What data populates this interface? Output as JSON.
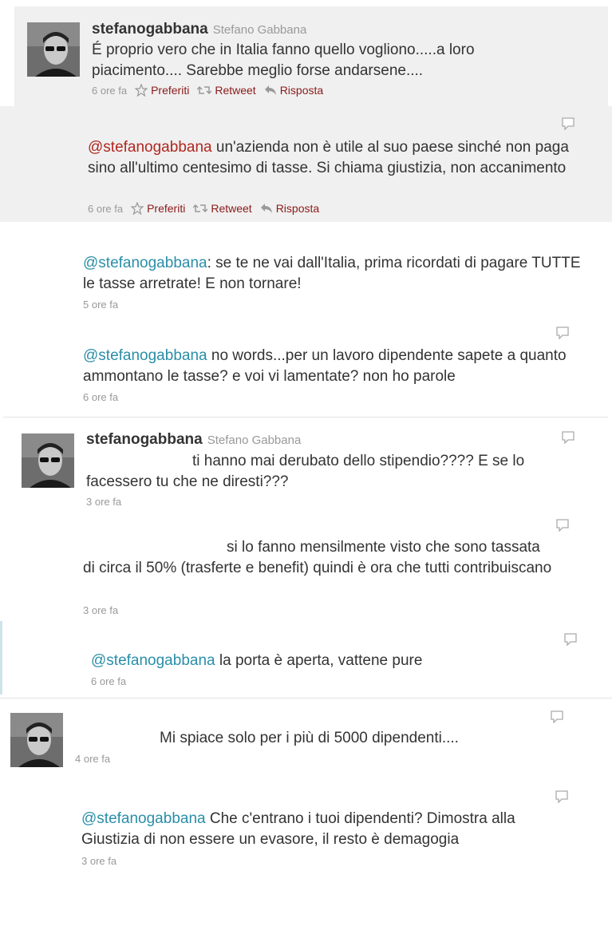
{
  "tweet1": {
    "username": "stefanogabbana",
    "fullname": "Stefano Gabbana",
    "text": "É proprio vero che in Italia fanno quello vogliono.....a loro piacimento.... Sarebbe meglio forse andarsene....",
    "time": "6 ore fa",
    "actions": {
      "favorite": "Preferiti",
      "retweet": "Retweet",
      "reply": "Risposta"
    }
  },
  "reply1": {
    "mention": "@stefanogabbana",
    "text": " un'azienda non è utile al suo paese sinché non paga sino all'ultimo centesimo di tasse. Si chiama giustizia, non accanimento",
    "time": "6 ore fa",
    "actions": {
      "favorite": "Preferiti",
      "retweet": "Retweet",
      "reply": "Risposta"
    }
  },
  "reply2": {
    "mention": "@stefanogabbana",
    "text": ": se te ne vai dall'Italia, prima ricordati di pagare TUTTE le tasse arretrate! E non tornare!",
    "time": "5 ore fa"
  },
  "reply3": {
    "mention": "@stefanogabbana",
    "text": " no words...per un lavoro dipendente sapete a quanto ammontano le tasse? e voi vi lamentate? non ho parole",
    "time": "6 ore fa"
  },
  "tweet2": {
    "username": "stefanogabbana",
    "fullname": "Stefano Gabbana",
    "text_line1": "ti hanno mai derubato dello stipendio???? E se lo",
    "text_line2": "facessero tu che ne diresti???",
    "time": "3 ore fa"
  },
  "reply4": {
    "text_line1": "si lo fanno mensilmente visto che sono tassata",
    "text_rest": "di circa il 50% (trasferte e benefit) quindi è ora che tutti contribuiscano",
    "time": "3 ore fa"
  },
  "reply5": {
    "mention": "@stefanogabbana",
    "text": " la porta è aperta, vattene pure",
    "time": "6 ore fa"
  },
  "tweet3": {
    "text": "Mi spiace solo per i più di 5000 dipendenti....",
    "time": "4 ore fa"
  },
  "reply6": {
    "mention": "@stefanogabbana",
    "text": " Che c'entrano i tuoi dipendenti? Dimostra alla Giustizia di non essere un evasore, il resto è demagogia",
    "time": "3 ore fa"
  },
  "colors": {
    "mention_red": "#b0271f",
    "mention_blue": "#2a8ea8",
    "panel_bg": "#f0f0f0",
    "meta": "#999999"
  },
  "icons": [
    "avatar",
    "star-icon",
    "retweet-icon",
    "reply-icon",
    "speech-bubble-icon"
  ]
}
